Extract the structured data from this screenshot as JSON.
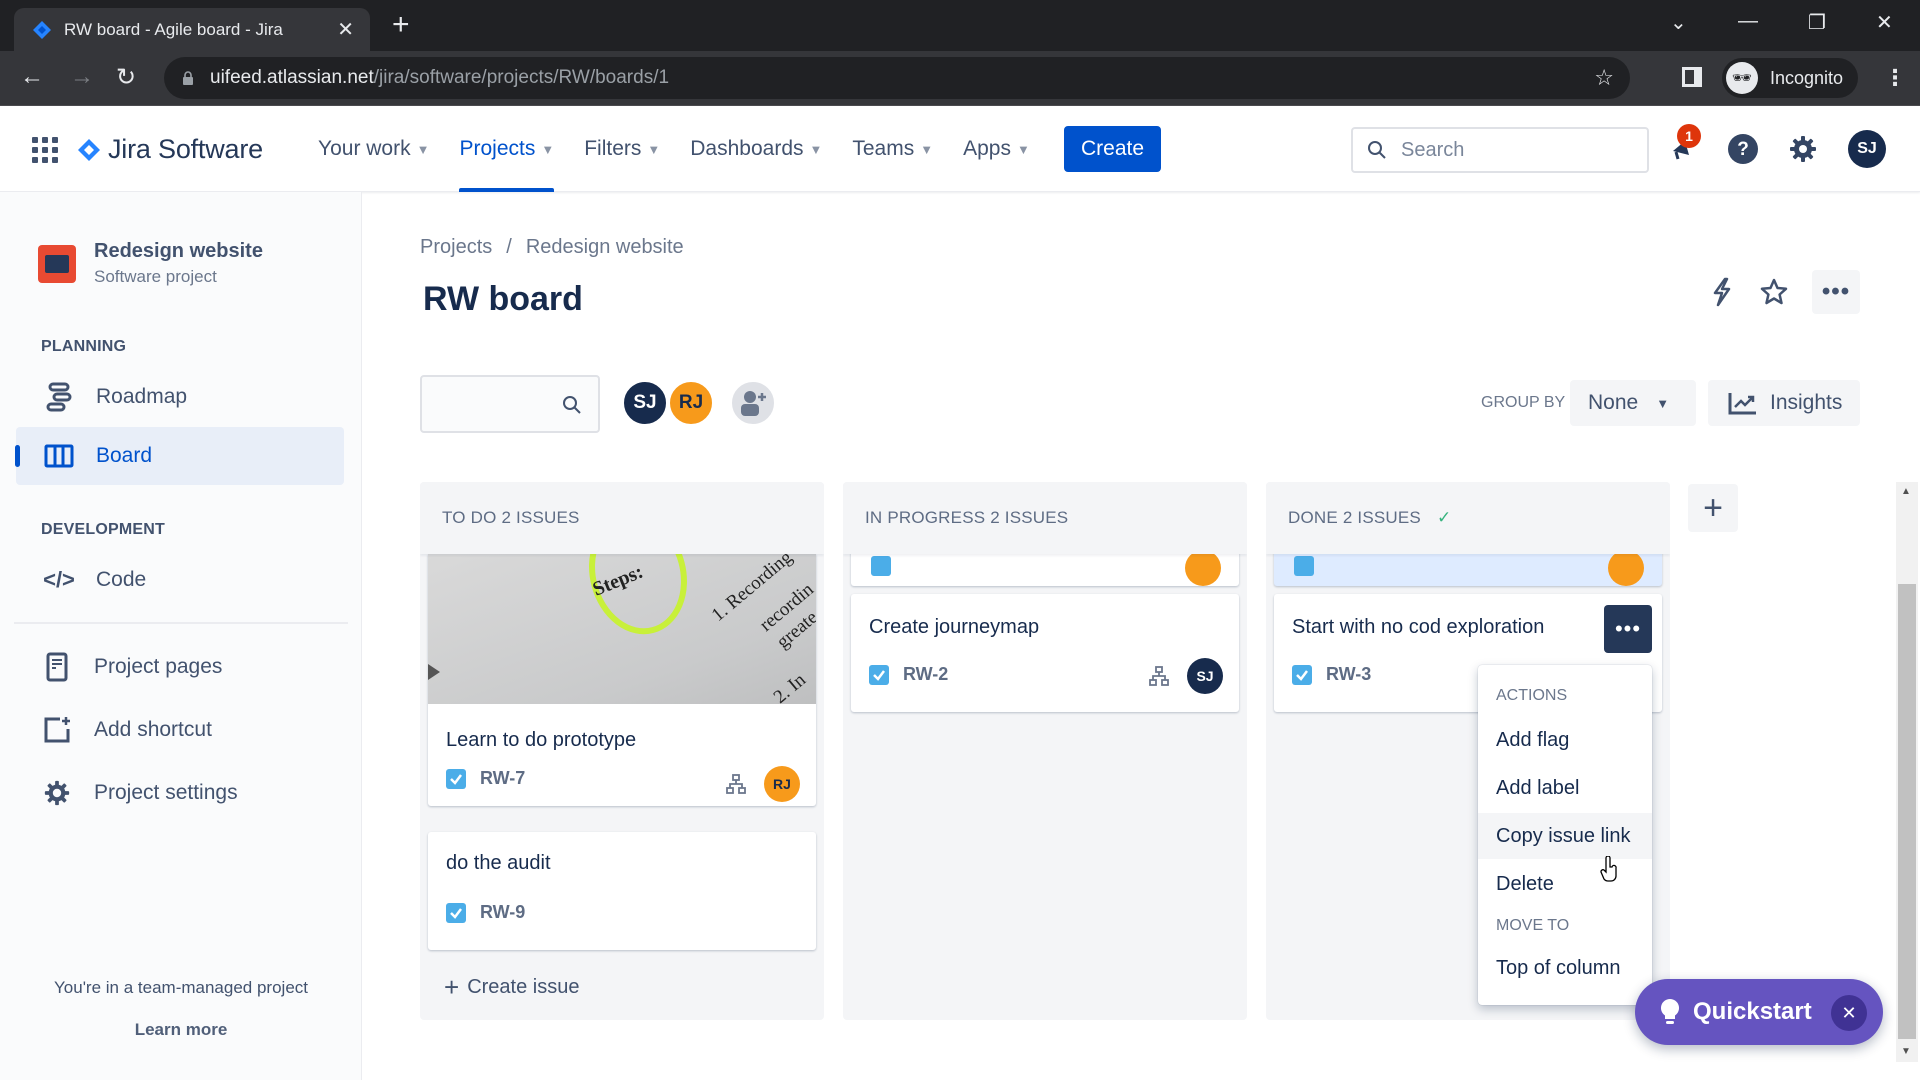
{
  "browser": {
    "tab_title": "RW board - Agile board - Jira",
    "url_host": "uifeed.atlassian.net",
    "url_path": "/jira/software/projects/RW/boards/1",
    "profile_label": "Incognito"
  },
  "topnav": {
    "product_name": "Jira Software",
    "items": [
      {
        "label": "Your work",
        "active": false
      },
      {
        "label": "Projects",
        "active": true
      },
      {
        "label": "Filters",
        "active": false
      },
      {
        "label": "Dashboards",
        "active": false
      },
      {
        "label": "Teams",
        "active": false
      },
      {
        "label": "Apps",
        "active": false
      }
    ],
    "create_label": "Create",
    "search_placeholder": "Search",
    "notification_count": "1",
    "user_initials": "SJ"
  },
  "sidebar": {
    "project_name": "Redesign website",
    "project_type": "Software project",
    "planning_header": "PLANNING",
    "development_header": "DEVELOPMENT",
    "planning_items": [
      {
        "label": "Roadmap",
        "icon": "roadmap-icon"
      },
      {
        "label": "Board",
        "icon": "board-icon",
        "active": true
      }
    ],
    "development_items": [
      {
        "label": "Code",
        "icon": "code-icon"
      }
    ],
    "other_items": [
      {
        "label": "Project pages",
        "icon": "page-icon"
      },
      {
        "label": "Add shortcut",
        "icon": "add-shortcut-icon"
      },
      {
        "label": "Project settings",
        "icon": "gear-icon"
      }
    ],
    "footer_text": "You're in a team-managed project",
    "footer_link": "Learn more"
  },
  "main": {
    "breadcrumb": [
      "Projects",
      "Redesign website"
    ],
    "title": "RW board",
    "search_value": "",
    "avatars": [
      "SJ",
      "RJ"
    ],
    "group_by_label": "GROUP BY",
    "group_by_value": "None",
    "insights_label": "Insights"
  },
  "board": {
    "columns": [
      {
        "title": "TO DO 2 ISSUES",
        "done": false,
        "cards": [
          {
            "title": "Learn to do prototype",
            "key": "RW-7",
            "assignee": "RJ",
            "has_subtasks": true,
            "has_cover": true,
            "cover_text": [
              "Steps:",
              "1. Recording",
              "recordin",
              "greate",
              "2. In"
            ]
          },
          {
            "title": "do the audit",
            "key": "RW-9",
            "assignee": "",
            "has_subtasks": false
          }
        ],
        "create_issue_label": "Create issue"
      },
      {
        "title": "IN PROGRESS 2 ISSUES",
        "done": false,
        "cards": [
          {
            "title": "",
            "key": "",
            "assignee": "RJ",
            "partial": true
          },
          {
            "title": "Create journeymap",
            "key": "RW-2",
            "assignee": "SJ",
            "has_subtasks": true
          }
        ]
      },
      {
        "title": "DONE 2 ISSUES",
        "done": true,
        "cards": [
          {
            "title": "",
            "key": "",
            "assignee": "RJ",
            "partial": true
          },
          {
            "title": "Start with no cod exploration",
            "key": "RW-3",
            "assignee": "",
            "has_subtasks": false
          }
        ]
      }
    ]
  },
  "card_menu": {
    "actions_header": "ACTIONS",
    "actions": [
      "Add flag",
      "Add label",
      "Copy issue link",
      "Delete"
    ],
    "hovered": "Copy issue link",
    "move_header": "MOVE TO",
    "move_items": [
      "Top of column"
    ]
  },
  "quickstart": {
    "label": "Quickstart"
  },
  "colors": {
    "brand_blue": "#0052cc",
    "quickstart_purple": "#6554c0",
    "avatar_sj": "#172b4d",
    "avatar_rj": "#f79a1b",
    "done_check": "#36b37e"
  }
}
